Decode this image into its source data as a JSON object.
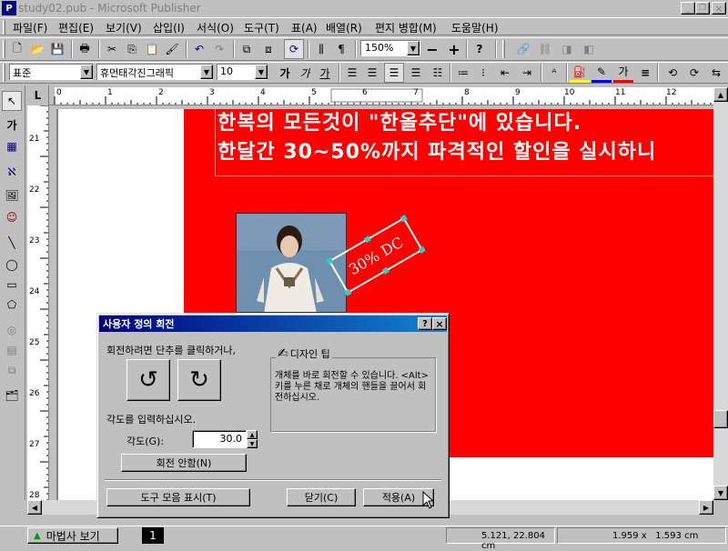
{
  "window": {
    "title": "study02.pub - Microsoft Publisher",
    "controls": [
      "_",
      "❐",
      "×"
    ]
  },
  "menu": [
    "파일(F)",
    "편집(E)",
    "보기(V)",
    "삽입(I)",
    "서식(O)",
    "도구(T)",
    "표(A)",
    "배열(R)",
    "편지 병합(M)",
    "도움말(H)"
  ],
  "standard_toolbar": {
    "zoom": "150%"
  },
  "format_toolbar": {
    "style": "표준",
    "font": "휴먼태각진그래픽",
    "size": "10",
    "bold": "가",
    "italic": "가",
    "underline": "가"
  },
  "ruler": {
    "h_ticks": [
      "0",
      "1",
      "2",
      "3",
      "4",
      "5",
      "6",
      "7",
      "8",
      "9",
      "10",
      "11",
      "12"
    ],
    "v_ticks": [
      "21",
      "22",
      "23",
      "24",
      "25",
      "26",
      "27",
      "28"
    ]
  },
  "document": {
    "line1": "한복의 모든것이 \"한올추단\"에 있습니다.",
    "line2": "한달간 30~50%까지 파격적인 할인을 실시하니",
    "badge": "30% DC"
  },
  "dialog": {
    "title": "사용자 정의 회전",
    "instruction": "회전하려면 단추를 클릭하거나,",
    "design_tip_title": "디자인 팁",
    "design_tip_text": "개체를 바로 회전할 수 있습니다. <Alt> 키를 누른 채로 개체의 핸들을 끌어서 회전하십시오.",
    "angle_prompt": "각도를 입력하십시오.",
    "angle_label": "각도(G):",
    "angle_value": "30.0",
    "no_rotate_button": "회전 안함(N)",
    "toolbar_button": "도구 모음 표시(T)",
    "close_button": "닫기(C)",
    "apply_button": "적용(A)"
  },
  "statusbar": {
    "wizard": "마법사 보기",
    "page": "1",
    "position": "5.121, 22.804 cm",
    "size": "1.959 x   1.593 cm"
  }
}
